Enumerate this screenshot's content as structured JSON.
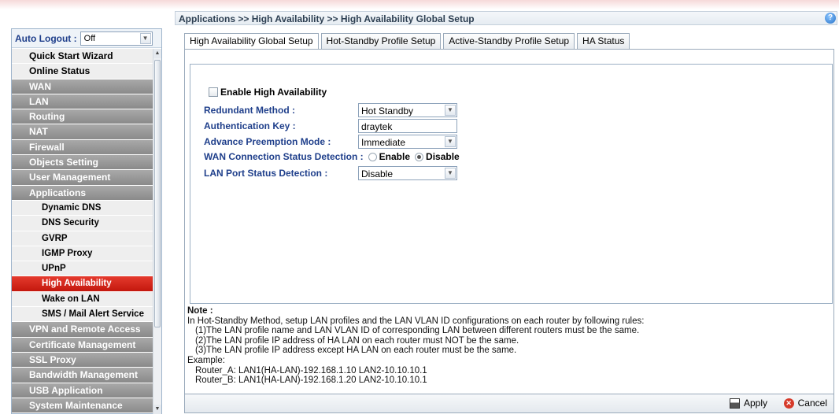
{
  "header": {
    "breadcrumb": "Applications >> High Availability >> High Availability Global Setup",
    "help_icon": "help-icon"
  },
  "sidebar": {
    "auto_logout_label": "Auto Logout :",
    "auto_logout_value": "Off",
    "items": [
      {
        "label": "Quick Start Wizard",
        "style": "white"
      },
      {
        "label": "Online Status",
        "style": "white"
      },
      {
        "label": "WAN",
        "style": "gray"
      },
      {
        "label": "LAN",
        "style": "gray"
      },
      {
        "label": "Routing",
        "style": "gray"
      },
      {
        "label": "NAT",
        "style": "gray"
      },
      {
        "label": "Firewall",
        "style": "gray"
      },
      {
        "label": "Objects Setting",
        "style": "gray"
      },
      {
        "label": "User Management",
        "style": "gray"
      },
      {
        "label": "Applications",
        "style": "gray"
      },
      {
        "label": "Dynamic DNS",
        "style": "sub"
      },
      {
        "label": "DNS Security",
        "style": "sub"
      },
      {
        "label": "GVRP",
        "style": "sub"
      },
      {
        "label": "IGMP Proxy",
        "style": "sub"
      },
      {
        "label": "UPnP",
        "style": "sub"
      },
      {
        "label": "High Availability",
        "style": "sub",
        "active": true
      },
      {
        "label": "Wake on LAN",
        "style": "sub"
      },
      {
        "label": "SMS / Mail Alert Service",
        "style": "sub"
      },
      {
        "label": "VPN and Remote Access",
        "style": "gray"
      },
      {
        "label": "Certificate Management",
        "style": "gray"
      },
      {
        "label": "SSL Proxy",
        "style": "gray"
      },
      {
        "label": "Bandwidth Management",
        "style": "gray"
      },
      {
        "label": "USB Application",
        "style": "gray"
      },
      {
        "label": "System Maintenance",
        "style": "gray"
      }
    ]
  },
  "tabs": [
    {
      "label": "High Availability Global Setup",
      "selected": true
    },
    {
      "label": "Hot-Standby Profile Setup"
    },
    {
      "label": "Active-Standby Profile Setup"
    },
    {
      "label": "HA Status"
    }
  ],
  "form": {
    "enable_label": "Enable High Availability",
    "enable_checked": false,
    "redundant_method_label": "Redundant Method :",
    "redundant_method_value": "Hot Standby",
    "auth_key_label": "Authentication Key :",
    "auth_key_value": "draytek",
    "preemption_label": "Advance Preemption Mode :",
    "preemption_value": "Immediate",
    "wan_detection_label": "WAN Connection Status Detection :",
    "wan_enable_label": "Enable",
    "wan_disable_label": "Disable",
    "wan_selected": "Disable",
    "lan_detection_label": "LAN Port Status Detection :",
    "lan_detection_value": "Disable"
  },
  "note": {
    "title": "Note :",
    "intro": "In Hot-Standby Method, setup LAN profiles and the LAN VLAN ID configurations on each router by following rules:",
    "rules": [
      "(1)The LAN profile name and LAN VLAN ID of corresponding LAN between different routers must be the same.",
      "(2)The LAN profile IP address of HA LAN on each router must NOT be the same.",
      "(3)The LAN profile IP address except HA LAN on each router must be the same."
    ],
    "example_label": "Example:",
    "examples": [
      "Router_A:  LAN1(HA-LAN)-192.168.1.10  LAN2-10.10.10.1",
      "Router_B:  LAN1(HA-LAN)-192.168.1.20  LAN2-10.10.10.1"
    ]
  },
  "footer": {
    "apply_label": "Apply",
    "cancel_label": "Cancel"
  },
  "colors": {
    "accent_red": "#c3170d",
    "menu_gray": "#8a8a8a",
    "label_blue": "#1f3f8b"
  }
}
